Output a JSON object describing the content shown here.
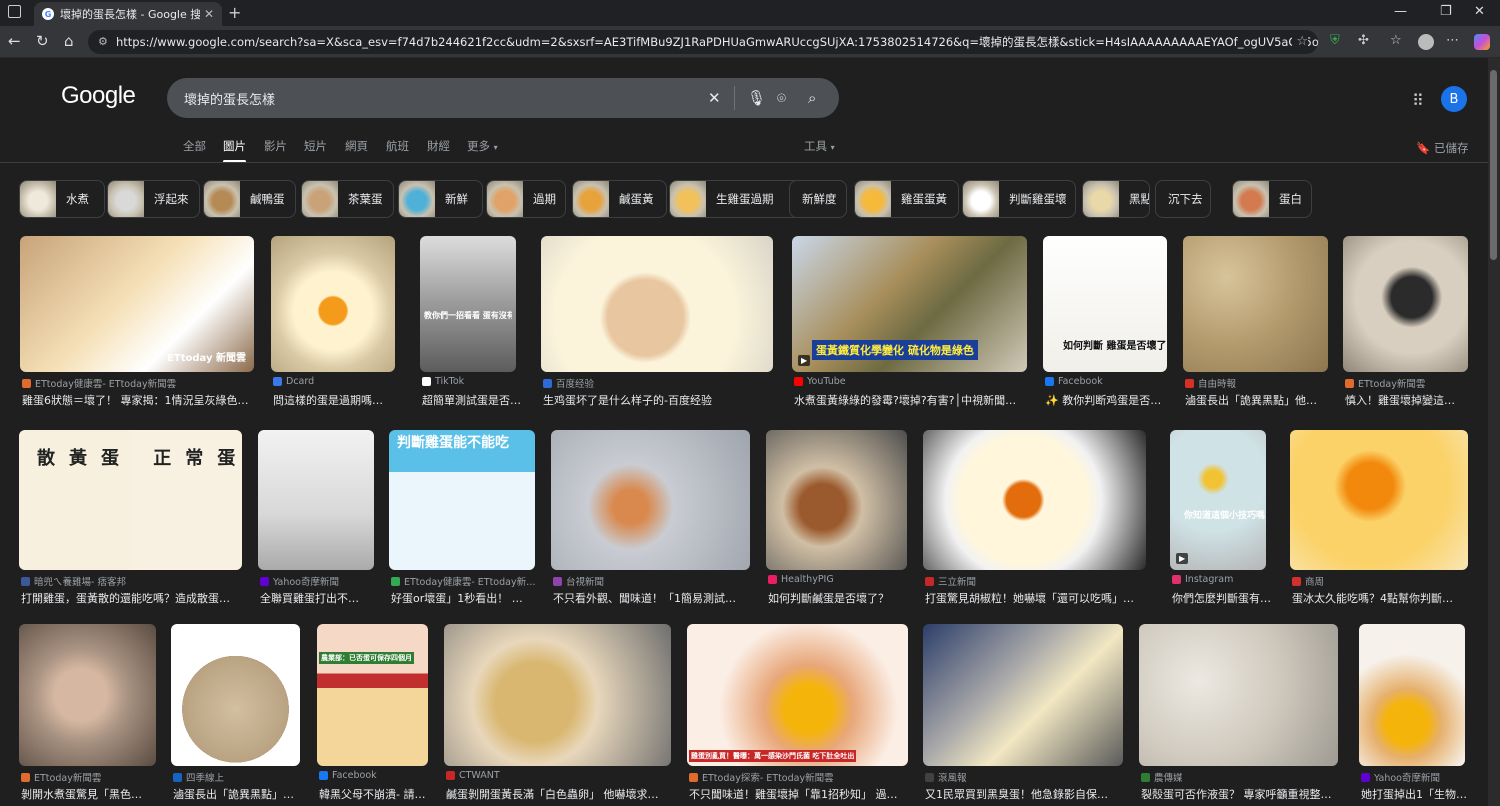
{
  "browser": {
    "tab_title": "壞掉的蛋長怎樣 - Google 搜尋",
    "url": "https://www.google.com/search?sa=X&sca_esv=f74d7b244621f2cc&udm=2&sxsrf=AE3TifMBu9ZJ1RaPDHUaGmwARUccgSUjXA:1753802514726&q=壞掉的蛋長怎樣&stick=H4sIAAAAAAAAAEYAOf_ogUV5aOe5o6J55qE6JuL6ZW35oCO5qij_..."
  },
  "google": {
    "logo": "Google",
    "query": "壞掉的蛋長怎樣",
    "avatar_letter": "B"
  },
  "nav": {
    "tabs": [
      "全部",
      "圖片",
      "影片",
      "短片",
      "網頁",
      "航班",
      "財經",
      "更多"
    ],
    "active": "圖片",
    "tools": "工具",
    "saved": "已儲存"
  },
  "chips": [
    "水煮",
    "浮起來",
    "鹹鴨蛋",
    "茶葉蛋",
    "新鮮",
    "過期",
    "鹹蛋黃",
    "生雞蛋過期",
    "新鮮度",
    "雞蛋蛋黃",
    "判斷雞蛋壞",
    "黑點",
    "沉下去",
    "蛋白"
  ],
  "results": [
    {
      "source": "ETtoday健康雲- ETtoday新聞雲",
      "title": "雞蛋6狀態＝壞了！ 專家揭：1情況呈灰綠色…",
      "overlay": "ETtoday 新聞雲",
      "color": "#e06b2c"
    },
    {
      "source": "Dcard",
      "title": "問這樣的蛋是過期嗎…",
      "overlay": "",
      "color": "#3b78e7"
    },
    {
      "source": "TikTok",
      "title": "超簡單測試蛋是否…",
      "overlay": "教你們一招看看 蛋有沒有壞掉",
      "color": "#ffffff"
    },
    {
      "source": "百度经验",
      "title": "生鸡蛋坏了是什么样子的-百度经验",
      "overlay": "",
      "color": "#2f6bd8"
    },
    {
      "source": "YouTube",
      "title": "水煮蛋黃綠綠的發霉?壞掉?有害?│中視新聞…",
      "overlay": "蛋黃鐵質化學變化 硫化物是綠色",
      "color": "#ff0000"
    },
    {
      "source": "Facebook",
      "title": "✨ 教你判断鸡蛋是否…",
      "overlay": "如何判斷 雞蛋是否壞了",
      "color": "#1877f2"
    },
    {
      "source": "自由時報",
      "title": "滷蛋長出「詭異黑點」他…",
      "overlay": "",
      "color": "#d93025"
    },
    {
      "source": "ETtoday新聞雲",
      "title": "慎入！雞蛋壞掉變這…",
      "overlay": "",
      "color": "#e06b2c"
    },
    {
      "source": "暗兜ㄟ養雞場- 痞客邦",
      "title": "打開雞蛋，蛋黃散的還能吃嗎？造成散蛋…",
      "overlay": "散黃蛋 正常蛋",
      "color": "#3b5998"
    },
    {
      "source": "Yahoo奇摩新聞",
      "title": "全聯買雞蛋打出不…",
      "overlay": "",
      "color": "#6001d2"
    },
    {
      "source": "ETtoday健康雲- ETtoday新…",
      "title": "好蛋or壞蛋」1秒看出！ …",
      "overlay": "判斷雞蛋能不能吃",
      "color": "#34a853"
    },
    {
      "source": "台視新聞",
      "title": "不只看外觀、聞味道！「1簡易測試…",
      "overlay": "",
      "color": "#8e44ad"
    },
    {
      "source": "HealthyPIG",
      "title": "如何判斷鹹蛋是否壞了？",
      "overlay": "",
      "color": "#e91e63"
    },
    {
      "source": "三立新聞",
      "title": "打蛋驚見胡椒粒！她嚇壞「還可以吃嗎」…",
      "overlay": "",
      "color": "#c62828"
    },
    {
      "source": "Instagram",
      "title": "你們怎麼判斷蛋有…",
      "overlay": "你知道這個小技巧嗎",
      "color": "#e1306c"
    },
    {
      "source": "商周",
      "title": "蛋冰太久能吃嗎？4點幫你判斷…",
      "overlay": "",
      "color": "#d32f2f"
    },
    {
      "source": "ETtoday新聞雲",
      "title": "剝開水煮蛋驚見「黑色…",
      "overlay": "",
      "color": "#e06b2c"
    },
    {
      "source": "四季線上",
      "title": "滷蛋長出「詭異黑點」…",
      "overlay": "",
      "color": "#1565c0"
    },
    {
      "source": "Facebook",
      "title": "韓黑父母不崩潰- 請…",
      "overlay": "農業部：已否蛋可保存四個月",
      "color": "#1877f2"
    },
    {
      "source": "CTWANT",
      "title": "鹹蛋剝開蛋黃長滿「白色蟲卵」 他嚇壞求…",
      "overlay": "",
      "color": "#c62828"
    },
    {
      "source": "ETtoday探索- ETtoday新聞雲",
      "title": "不只聞味道！雞蛋壞掉「靠1招秒知」 過…",
      "overlay": "雞蛋別亂買！醫曝：萬一感染沙門氏菌 吃下肚全吐出",
      "color": "#e06b2c"
    },
    {
      "source": "滾風報",
      "title": "又1民眾買到黑臭蛋！他急錄影自保…",
      "overlay": "",
      "color": "#424242"
    },
    {
      "source": "農傳媒",
      "title": "裂殼蛋可否作液蛋？ 專家呼籲重視整…",
      "overlay": "",
      "color": "#2e7d32"
    },
    {
      "source": "Yahoo奇摩新聞",
      "title": "她打蛋掉出1「生物…",
      "overlay": "",
      "color": "#6001d2"
    }
  ]
}
